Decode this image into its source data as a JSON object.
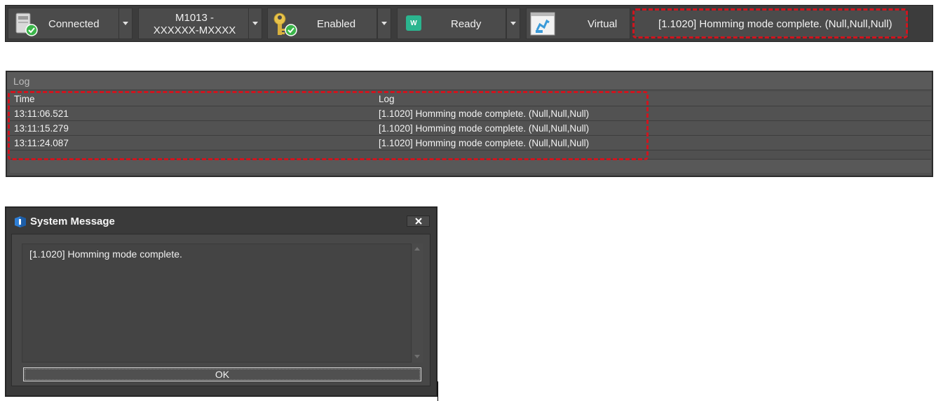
{
  "toolbar": {
    "connection": {
      "label": "Connected",
      "icon": "server-connected-icon"
    },
    "device": {
      "line1": "M1013 -",
      "line2": "XXXXXX-MXXXX"
    },
    "servo": {
      "label": "Enabled",
      "icon": "key-enabled-icon"
    },
    "state": {
      "label": "Ready",
      "badge": "W",
      "badge_color": "#2bb58f"
    },
    "mode": {
      "label": "Virtual",
      "icon": "robot-window-icon"
    },
    "status_message": "[1.1020] Homming mode complete. (Null,Null,Null)"
  },
  "log": {
    "title": "Log",
    "columns": [
      "Time",
      "Log"
    ],
    "rows": [
      {
        "time": "13:11:06.521",
        "message": "[1.1020] Homming mode complete. (Null,Null,Null)"
      },
      {
        "time": "13:11:15.279",
        "message": "[1.1020] Homming mode complete. (Null,Null,Null)"
      },
      {
        "time": "13:11:24.087",
        "message": "[1.1020] Homming mode complete. (Null,Null,Null)"
      }
    ]
  },
  "dialog": {
    "title": "System Message",
    "message": "[1.1020] Homming mode complete.",
    "ok_label": "OK"
  },
  "colors": {
    "highlight": "#d0141e",
    "panel": "#4b4b4b",
    "check_green": "#3bb54a"
  }
}
